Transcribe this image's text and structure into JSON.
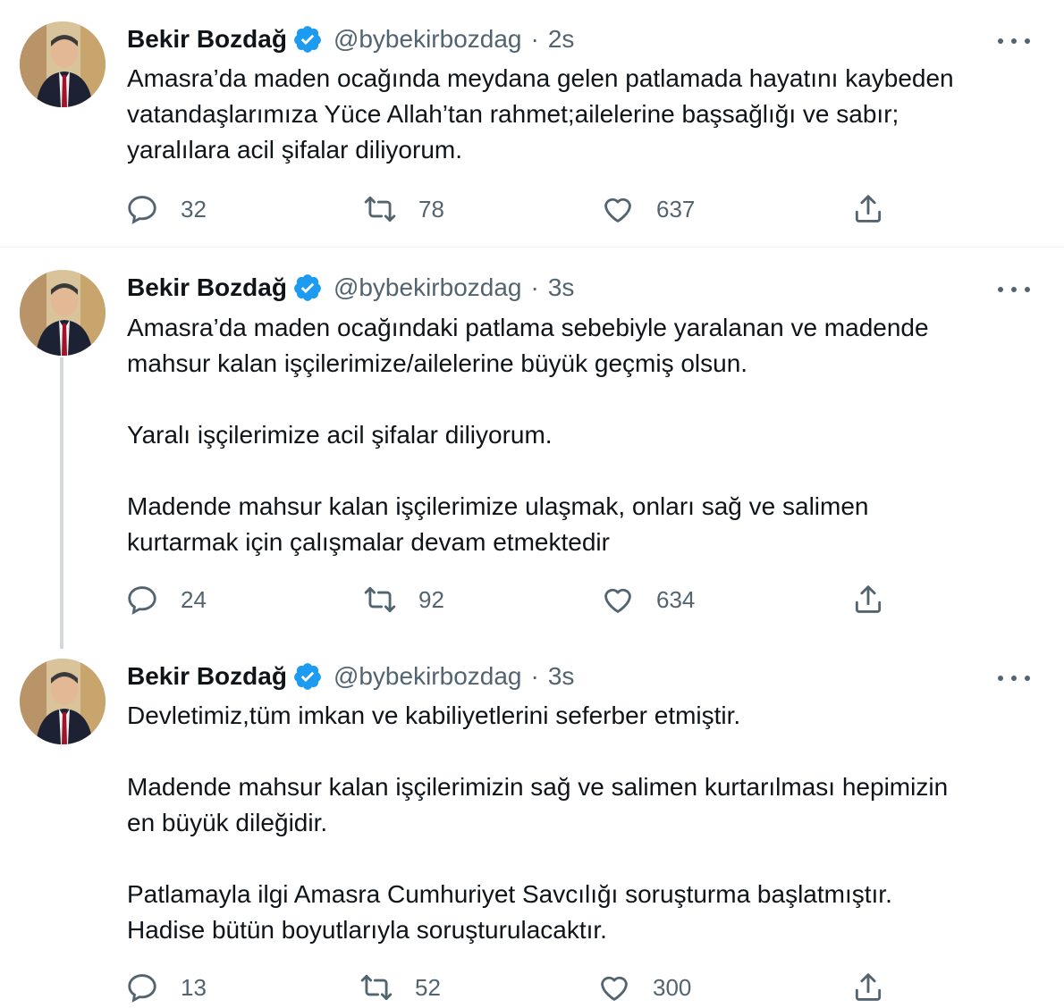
{
  "tweets": [
    {
      "name": "Bekir Bozdağ",
      "handle": "@bybekirbozdag",
      "separator": "·",
      "time": "2s",
      "lines": [
        "Amasra’da maden ocağında meydana gelen patlamada hayatını kaybeden",
        "vatandaşlarımıza Yüce Allah’tan rahmet;ailelerine başsağlığı ve sabır;",
        "yaralılara acil şifalar diliyorum."
      ],
      "replies": "32",
      "retweets": "78",
      "likes": "637"
    },
    {
      "name": "Bekir Bozdağ",
      "handle": "@bybekirbozdag",
      "separator": "·",
      "time": "3s",
      "lines": [
        "Amasra’da maden ocağındaki patlama sebebiyle yaralanan ve madende",
        "mahsur kalan işçilerimize/ailelerine büyük geçmiş olsun.",
        "",
        "Yaralı işçilerimize acil şifalar diliyorum.",
        "",
        "Madende mahsur kalan işçilerimize ulaşmak, onları sağ ve salimen",
        "kurtarmak için çalışmalar devam etmektedir"
      ],
      "replies": "24",
      "retweets": "92",
      "likes": "634"
    },
    {
      "name": "Bekir Bozdağ",
      "handle": "@bybekirbozdag",
      "separator": "·",
      "time": "3s",
      "lines": [
        "Devletimiz,tüm imkan ve kabiliyetlerini seferber etmiştir.",
        "",
        "Madende mahsur kalan işçilerimizin sağ ve salimen kurtarılması hepimizin",
        "en büyük dileğidir.",
        "",
        "Patlamayla ilgi Amasra Cumhuriyet Savcılığı soruşturma başlatmıştır.",
        "Hadise bütün boyutlarıyla soruşturulacaktır."
      ],
      "replies": "13",
      "retweets": "52",
      "likes": "300"
    }
  ],
  "colors": {
    "text": "#0f1419",
    "secondary": "#536471",
    "verified": "#1d9bf0",
    "divider": "#eff3f4",
    "thread_line": "#cfd9de"
  },
  "icons": [
    "verified-badge-icon",
    "more-icon",
    "reply-icon",
    "retweet-icon",
    "like-icon",
    "share-icon"
  ]
}
